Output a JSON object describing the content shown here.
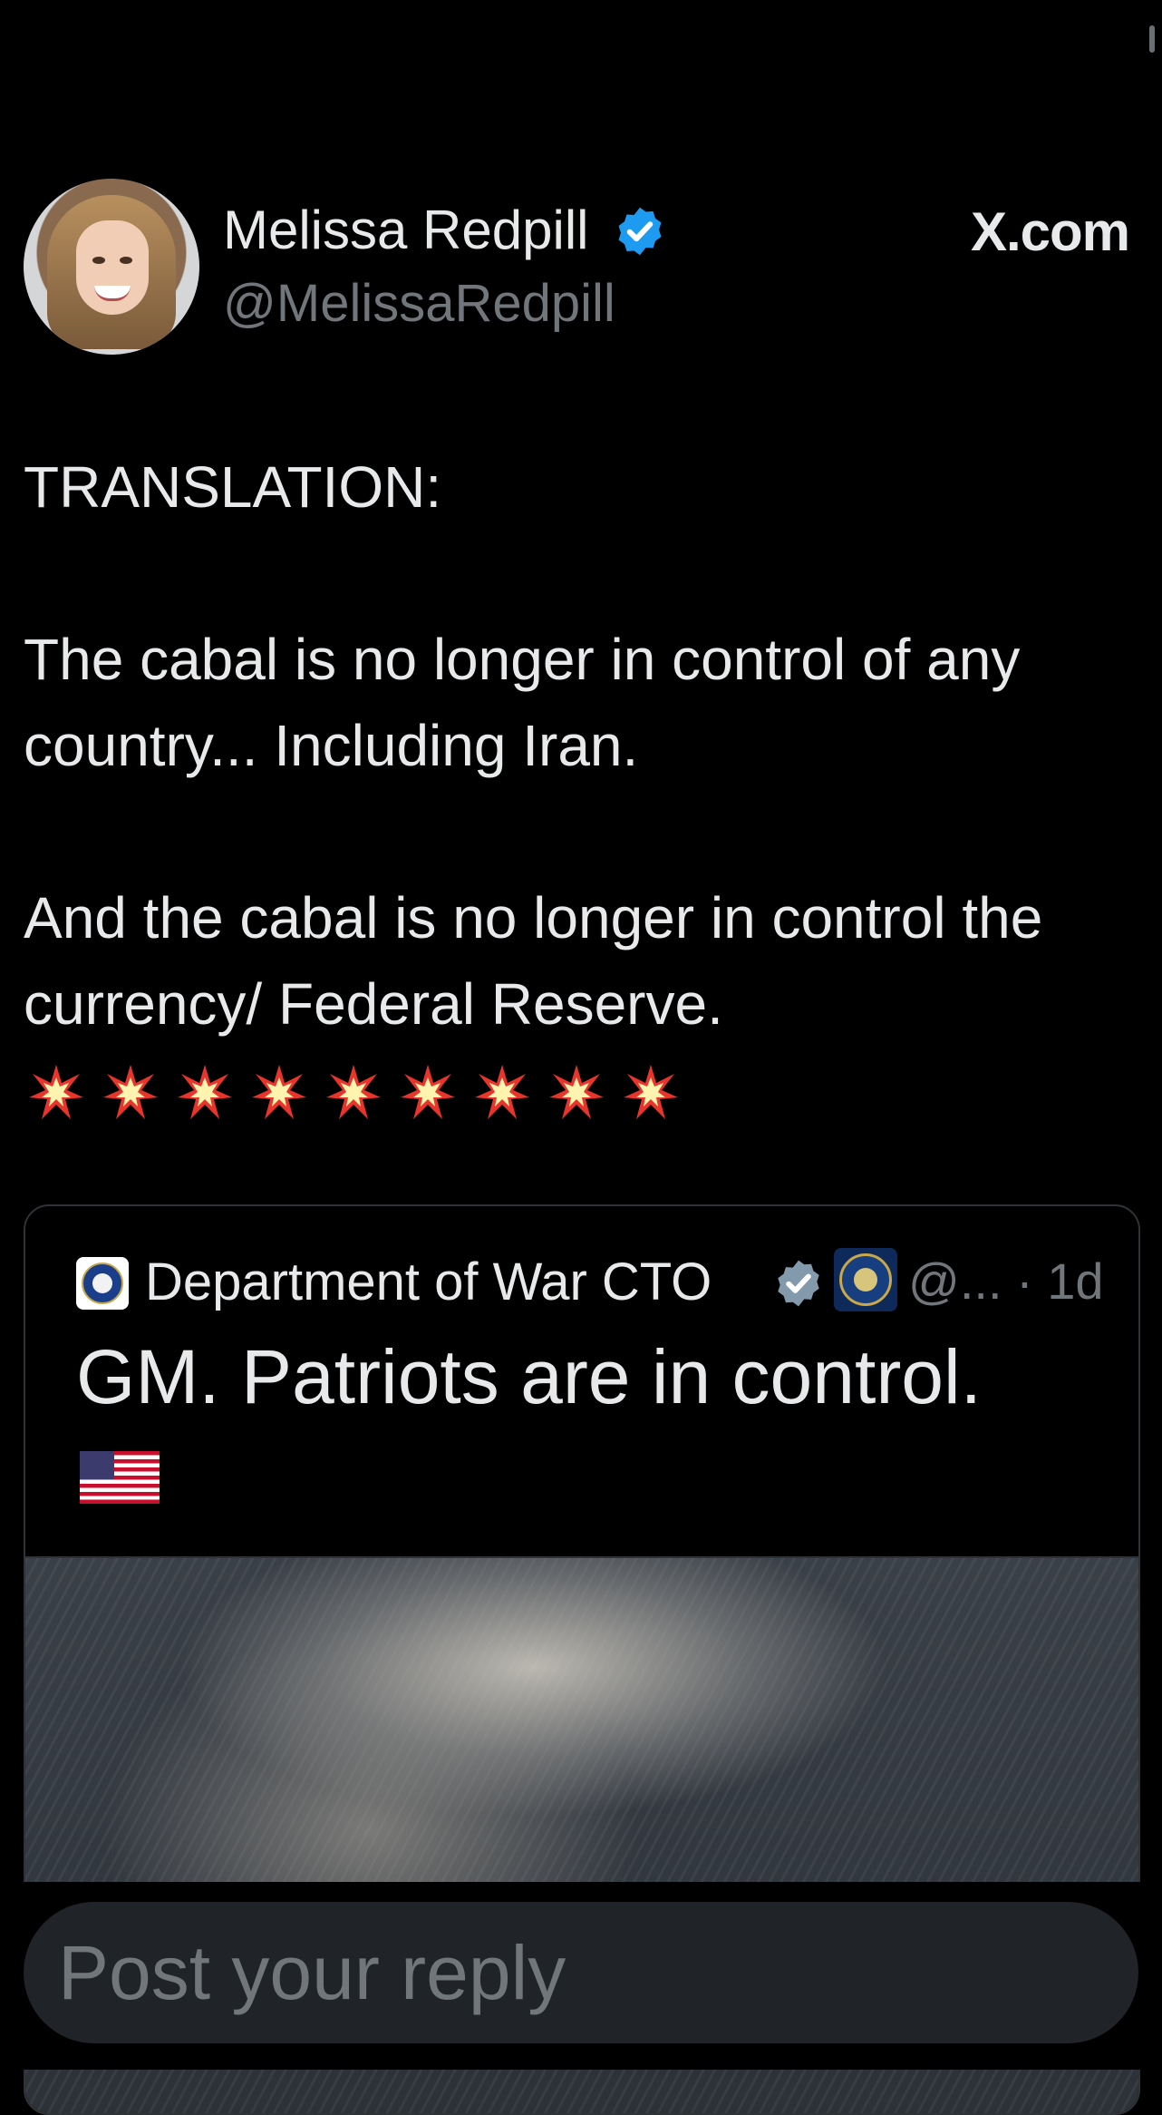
{
  "post": {
    "author_name": "Melissa Redpill",
    "handle": "@MelissaRedpill",
    "brand": "X.com",
    "text": "TRANSLATION:\n\nThe cabal is no longer in control of any country... Including Iran.\n\nAnd the cabal is no longer in control the currency/ Federal Reserve.",
    "emoji_row": "💥💥💥💥💥💥💥💥💥",
    "icons": {
      "avatar": "profile-photo",
      "verified": "verified-badge-blue",
      "emoji": "collision-emoji"
    },
    "colors": {
      "verified": "#1d9bf0",
      "text": "#e7e9ea",
      "muted": "#71767b",
      "background": "#000000"
    }
  },
  "quote": {
    "name": "Department of War CTO",
    "meta": "@... · 1d",
    "text": "GM. Patriots are in control.",
    "flag": "🇺🇸",
    "icons": {
      "logo": "department-of-war-logo",
      "badge": "verified-badge-gray",
      "affiliation": "department-seal",
      "media": "photo-thumbnail"
    }
  },
  "reply": {
    "placeholder": "Post your reply"
  }
}
